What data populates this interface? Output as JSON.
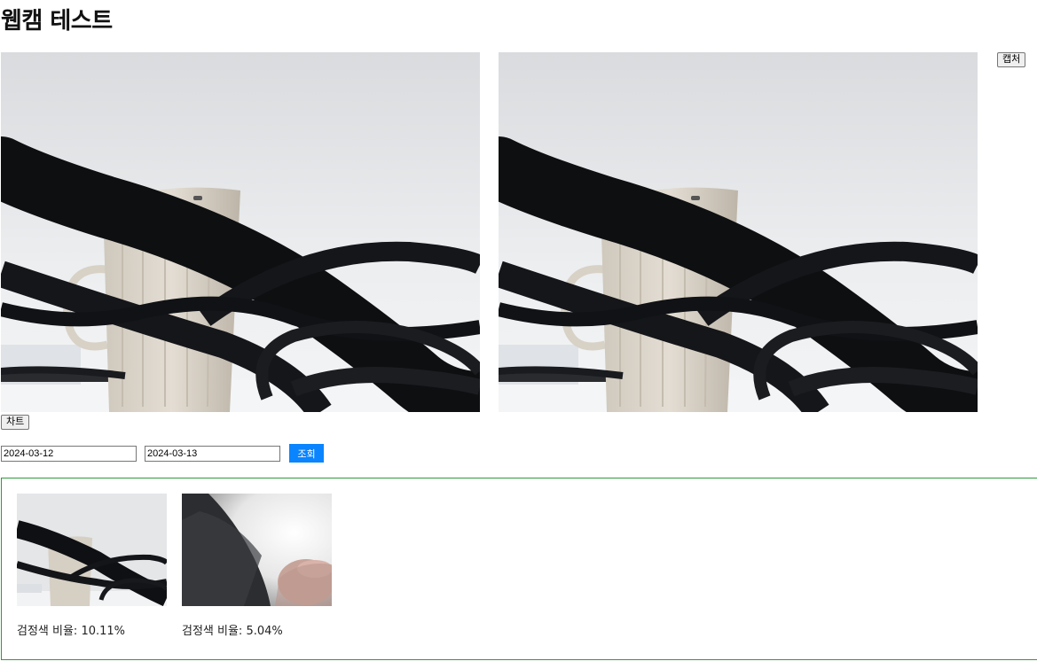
{
  "page": {
    "title": "웹캠 테스트"
  },
  "controls": {
    "capture_label": "캡처",
    "chart_label": "차트",
    "start_date": "2024-03-12",
    "end_date": "2024-03-13",
    "search_label": "조회"
  },
  "results": [
    {
      "label": "검정색 비율:",
      "value": "10.11%"
    },
    {
      "label": "검정색 비율:",
      "value": "5.04%"
    }
  ],
  "colors": {
    "search_button": "#0a84ff",
    "results_border": "#2e9a3a"
  }
}
